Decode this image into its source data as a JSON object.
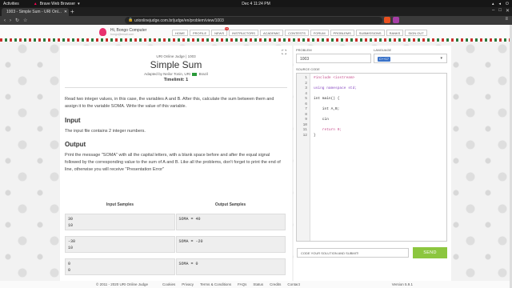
{
  "os": {
    "activities": "Activities",
    "app_name": "Brave Web Browser",
    "clock": "Dec 4  11:24 PM"
  },
  "browser": {
    "tab_title": "1003 - Simple Sum - URI Onl...",
    "url_display": "urionlinejudge.com.br/judge/en/problem/view/1003"
  },
  "site": {
    "greeting": "Hi, Bongo Computer",
    "email": "bongo@email.com",
    "nav": [
      {
        "label": "HOME"
      },
      {
        "label": "PROFILE"
      },
      {
        "label": "NEWS",
        "badge": "77"
      },
      {
        "label": "INSTRUCTORS"
      },
      {
        "label": "ACADEMIC"
      },
      {
        "label": "CONTESTS"
      },
      {
        "label": "FORUM"
      },
      {
        "label": "PROBLEMS"
      },
      {
        "label": "SUBMISSIONS"
      },
      {
        "label": "RANKS"
      },
      {
        "label": "SIGN OUT"
      }
    ]
  },
  "problem": {
    "judge": "URI Online Judge | 1003",
    "title": "Simple Sum",
    "adapted_prefix": "Adapted by Neilor Tonin, URI",
    "adapted_suffix": "Brazil",
    "timelimit": "Timelimit: 1",
    "description": "Read two integer values, in this case, the variables A and B. After this, calculate the sum between them and assign it to the variable SOMA. Write the value of this variable.",
    "input_heading": "Input",
    "input_text": "The input file contains 2 integer numbers.",
    "output_heading": "Output",
    "output_text": "Print the message \"SOMA\" with all the capital letters, with a blank space before and after the equal signal followed by the corresponding value to the sum of A and B. Like all the problems, don't forget to print the end of line, otherwise you will receive \"Presentation Error\"",
    "input_samples_header": "Input Samples",
    "output_samples_header": "Output Samples",
    "samples": [
      {
        "input": "30\n10",
        "output": "SOMA = 40"
      },
      {
        "input": "-30\n10",
        "output": "SOMA = -20"
      },
      {
        "input": "0\n0",
        "output": "SOMA = 0"
      }
    ]
  },
  "submit": {
    "problem_label": "PROBLEM",
    "problem_value": "1003",
    "language_label": "LANGUAGE",
    "language_value": "C++17",
    "source_label": "SOURCE CODE",
    "code_lines": [
      "#include <iostream>",
      "",
      "using namespace std;",
      "",
      "int main() {",
      "",
      "    int A,B;",
      "",
      "    cin",
      "",
      "    return 0;",
      "}"
    ],
    "submit_placeholder": "CODE YOUR SOLUTION AND SUBMIT!",
    "send_label": "SEND"
  },
  "footer": {
    "copyright": "© 2011 - 2020 URI Online Judge",
    "links": [
      "Cookies",
      "Privacy",
      "Terms & Conditions",
      "FAQs",
      "Status",
      "Credits",
      "Contact"
    ],
    "version": "Version 5.9.1"
  }
}
